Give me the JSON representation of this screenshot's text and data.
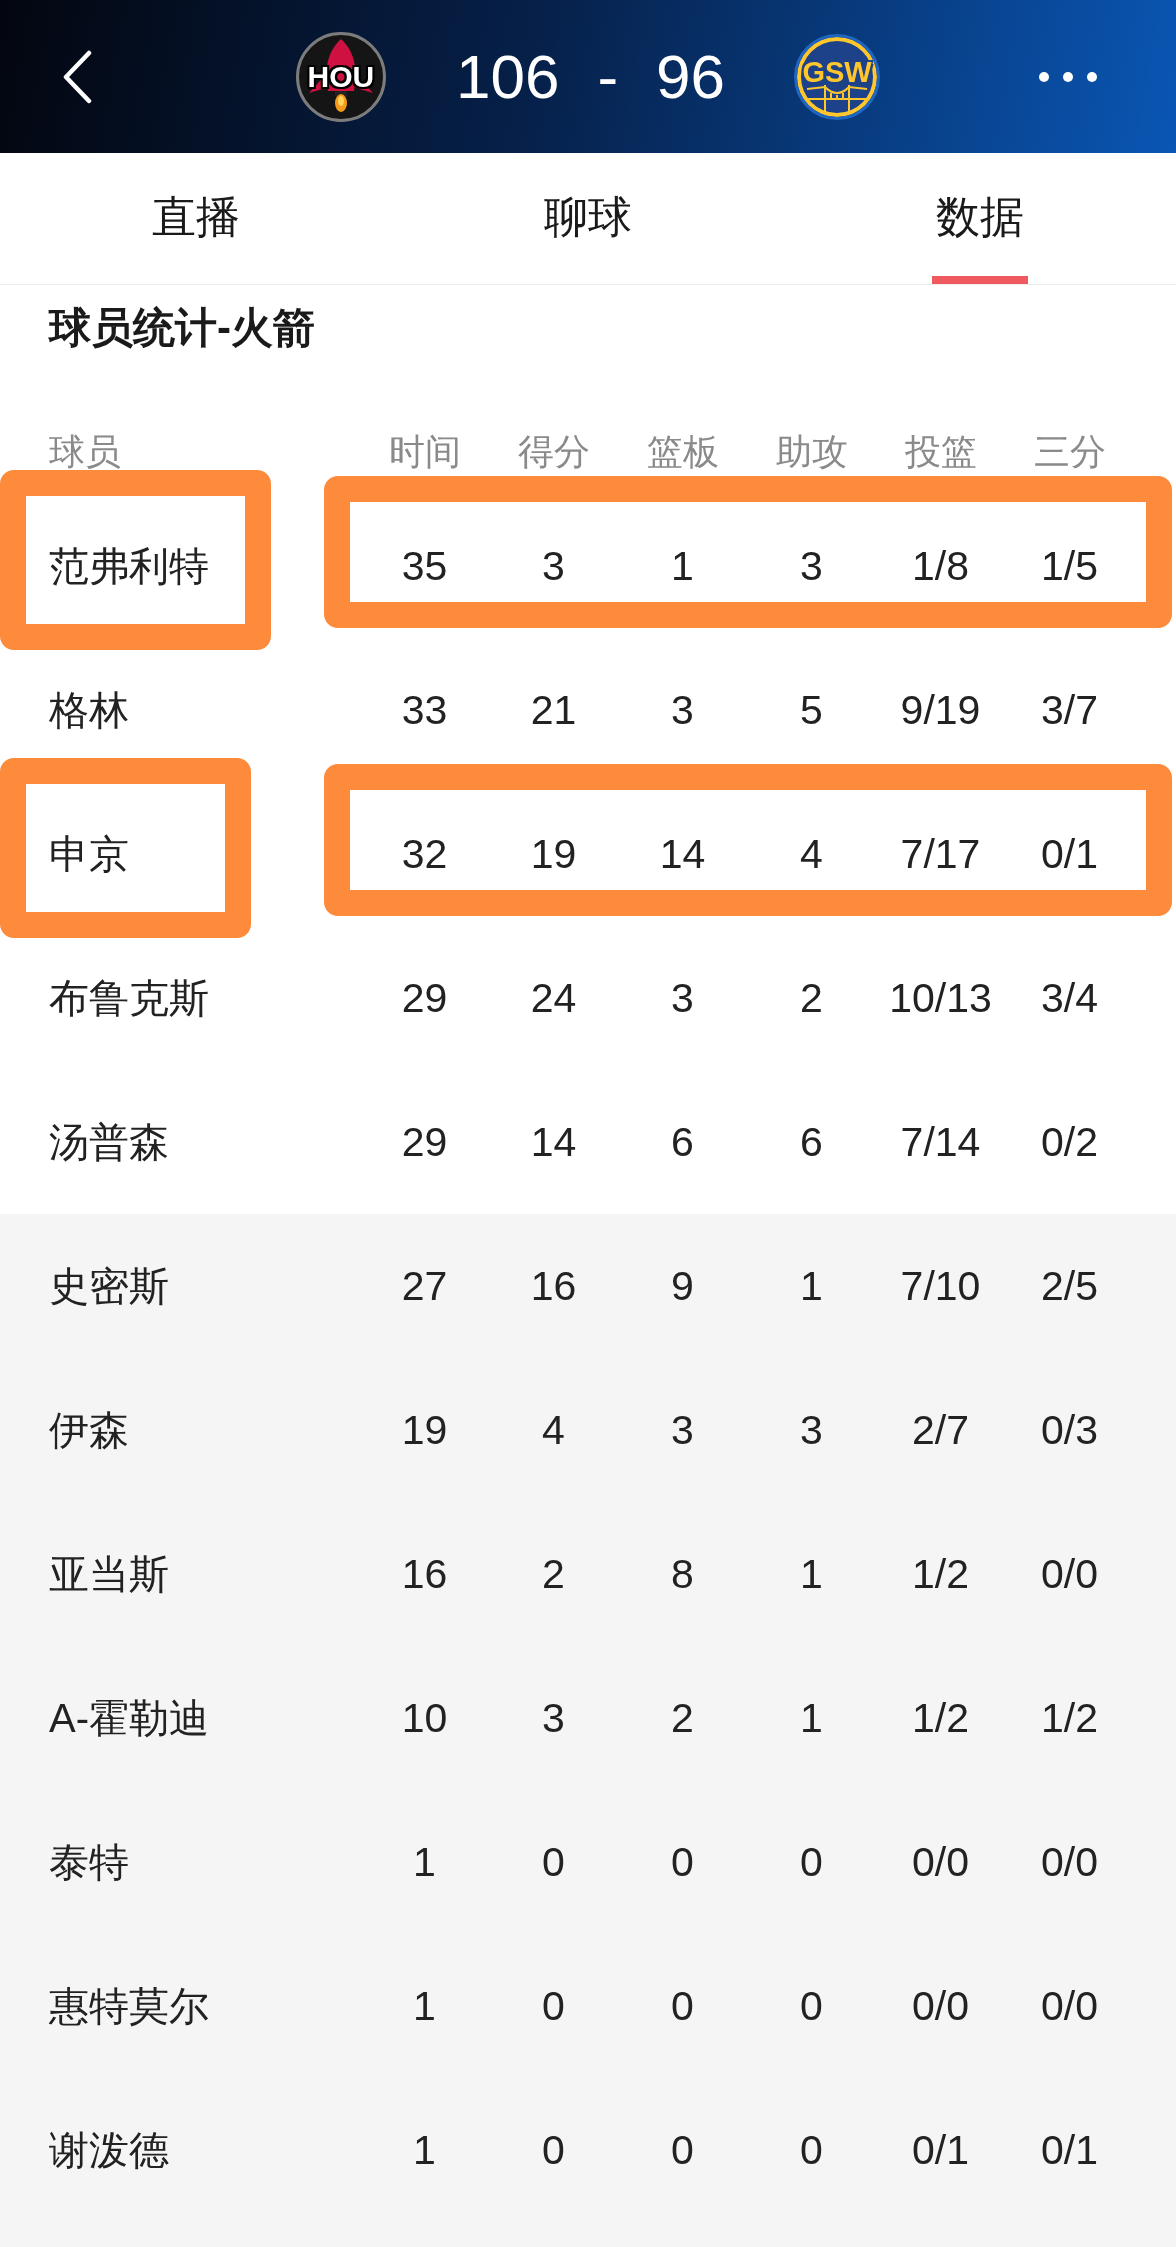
{
  "header": {
    "home_team": {
      "abbr": "HOU"
    },
    "home_score": "106",
    "separator": "-",
    "away_score": "96",
    "away_team": {
      "abbr": "GSW"
    }
  },
  "tabs": [
    {
      "label": "直播",
      "selected": false
    },
    {
      "label": "聊球",
      "selected": false
    },
    {
      "label": "数据",
      "selected": true
    }
  ],
  "section_title": "球员统计-火箭",
  "table": {
    "columns": [
      "球员",
      "时间",
      "得分",
      "篮板",
      "助攻",
      "投篮",
      "三分"
    ],
    "rows": [
      {
        "cells": [
          "范弗利特",
          "35",
          "3",
          "1",
          "3",
          "1/8",
          "1/5"
        ],
        "highlighted": true,
        "shaded": false
      },
      {
        "cells": [
          "格林",
          "33",
          "21",
          "3",
          "5",
          "9/19",
          "3/7"
        ],
        "highlighted": false,
        "shaded": false
      },
      {
        "cells": [
          "申京",
          "32",
          "19",
          "14",
          "4",
          "7/17",
          "0/1"
        ],
        "highlighted": true,
        "shaded": false
      },
      {
        "cells": [
          "布鲁克斯",
          "29",
          "24",
          "3",
          "2",
          "10/13",
          "3/4"
        ],
        "highlighted": false,
        "shaded": false
      },
      {
        "cells": [
          "汤普森",
          "29",
          "14",
          "6",
          "6",
          "7/14",
          "0/2"
        ],
        "highlighted": false,
        "shaded": false
      },
      {
        "cells": [
          "史密斯",
          "27",
          "16",
          "9",
          "1",
          "7/10",
          "2/5"
        ],
        "highlighted": false,
        "shaded": true
      },
      {
        "cells": [
          "伊森",
          "19",
          "4",
          "3",
          "3",
          "2/7",
          "0/3"
        ],
        "highlighted": false,
        "shaded": true
      },
      {
        "cells": [
          "亚当斯",
          "16",
          "2",
          "8",
          "1",
          "1/2",
          "0/0"
        ],
        "highlighted": false,
        "shaded": true
      },
      {
        "cells": [
          "A-霍勒迪",
          "10",
          "3",
          "2",
          "1",
          "1/2",
          "1/2"
        ],
        "highlighted": false,
        "shaded": true
      },
      {
        "cells": [
          "泰特",
          "1",
          "0",
          "0",
          "0",
          "0/0",
          "0/0"
        ],
        "highlighted": false,
        "shaded": true
      },
      {
        "cells": [
          "惠特莫尔",
          "1",
          "0",
          "0",
          "0",
          "0/0",
          "0/0"
        ],
        "highlighted": false,
        "shaded": true
      },
      {
        "cells": [
          "谢泼德",
          "1",
          "0",
          "0",
          "0",
          "0/1",
          "0/1"
        ],
        "highlighted": false,
        "shaded": true
      }
    ]
  }
}
